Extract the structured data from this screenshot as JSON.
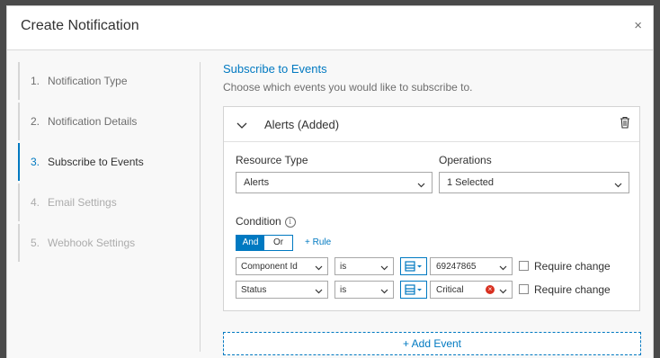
{
  "dialog": {
    "title": "Create Notification",
    "close_glyph": "×"
  },
  "steps": [
    {
      "num": "1.",
      "label": "Notification Type",
      "state": "done"
    },
    {
      "num": "2.",
      "label": "Notification Details",
      "state": "done"
    },
    {
      "num": "3.",
      "label": "Subscribe to Events",
      "state": "active"
    },
    {
      "num": "4.",
      "label": "Email Settings",
      "state": "disabled"
    },
    {
      "num": "5.",
      "label": "Webhook Settings",
      "state": "disabled"
    }
  ],
  "section": {
    "title": "Subscribe to Events",
    "subtitle": "Choose which events you would like to subscribe to."
  },
  "event_card": {
    "title": "Alerts (Added)",
    "resource_type_label": "Resource Type",
    "resource_type_value": "Alerts",
    "operations_label": "Operations",
    "operations_value": "1 Selected",
    "condition_label": "Condition",
    "info_glyph": "i",
    "and_label": "And",
    "or_label": "Or",
    "add_rule_label": "+  Rule",
    "rules": [
      {
        "field": "Component Id",
        "operator": "is",
        "value": "69247865",
        "require_change": "Require change",
        "has_clear": false
      },
      {
        "field": "Status",
        "operator": "is",
        "value": "Critical",
        "require_change": "Require change",
        "has_clear": true
      }
    ]
  },
  "add_event_label": "+   Add Event",
  "colors": {
    "accent": "#0079c1",
    "error": "#d83020",
    "backdrop": "#4a4a4a"
  }
}
